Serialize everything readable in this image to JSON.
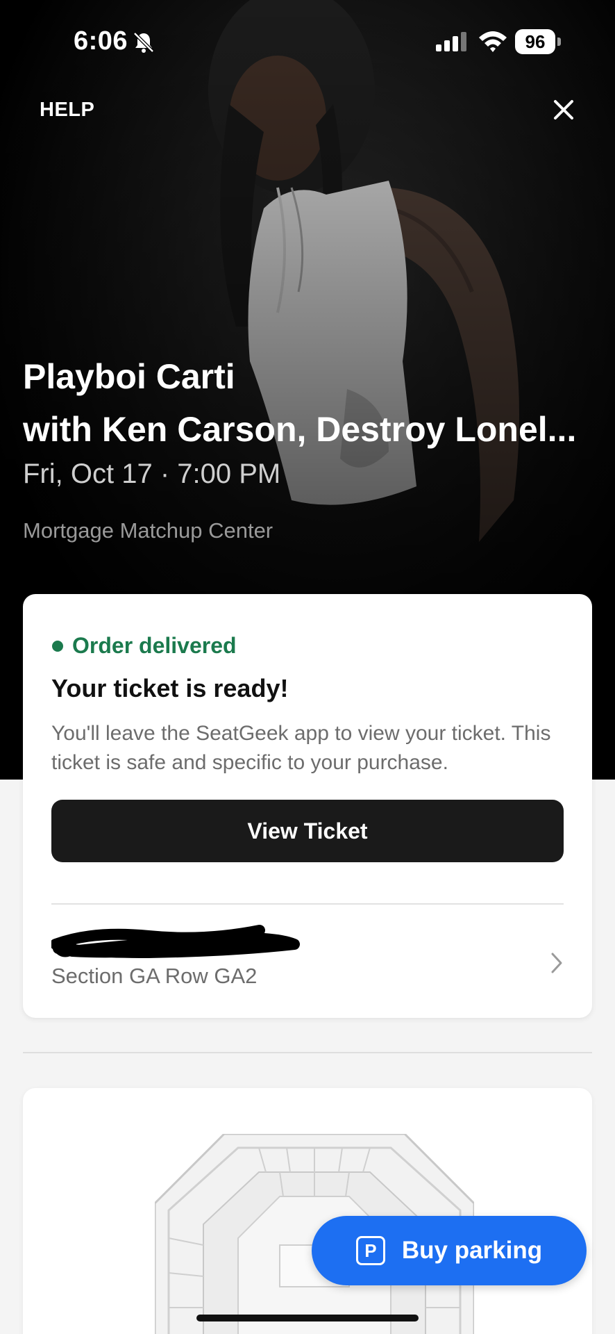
{
  "status_bar": {
    "time": "6:06",
    "battery": "96",
    "icons": [
      "bell-slash-icon",
      "cellular-signal-icon",
      "wifi-icon",
      "battery-icon"
    ]
  },
  "header": {
    "help_label": "HELP",
    "close_icon": "close-icon"
  },
  "event": {
    "title_line1": "Playboi Carti",
    "title_line2": "with Ken Carson, Destroy Lonel...",
    "date": "Fri, Oct 17 · 7:00 PM",
    "venue": "Mortgage Matchup Center"
  },
  "order_card": {
    "status": "Order delivered",
    "status_color": "#1b7a4d",
    "heading": "Your ticket is ready!",
    "description": "You'll leave the SeatGeek app to view your ticket. This ticket is safe and specific to your purchase.",
    "view_ticket_label": "View Ticket",
    "ticket_section": "Section GA Row GA2"
  },
  "parking": {
    "icon_letter": "P",
    "label": "Buy parking",
    "color": "#1d6ff2"
  }
}
